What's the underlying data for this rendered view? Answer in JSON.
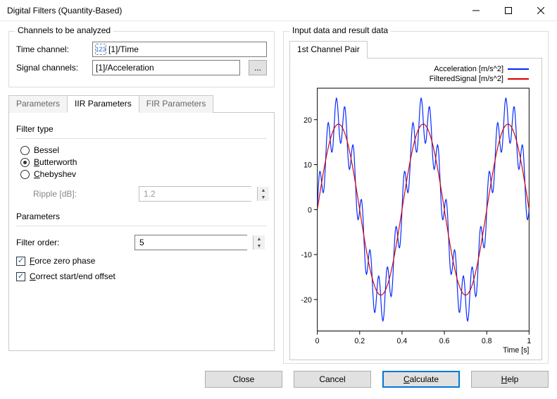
{
  "window": {
    "title": "Digital Filters (Quantity-Based)"
  },
  "channels": {
    "legend": "Channels to be analyzed",
    "time_label": "Time channel:",
    "time_value": "[1]/Time",
    "time_icon": "123",
    "signal_label": "Signal channels:",
    "signal_value": "[1]/Acceleration",
    "browse_label": "..."
  },
  "tabs": {
    "items": [
      "Parameters",
      "IIR Parameters",
      "FIR Parameters"
    ],
    "active_index": 1
  },
  "filter_type": {
    "legend": "Filter type",
    "options": [
      "Bessel",
      "Butterworth",
      "Chebyshev"
    ],
    "selected_index": 1,
    "ripple_label": "Ripple [dB]:",
    "ripple_value": "1.2"
  },
  "parameters": {
    "legend": "Parameters",
    "filter_order_label": "Filter order:",
    "filter_order_value": "5",
    "force_zero_phase_label": "Force zero phase",
    "force_zero_phase_checked": true,
    "correct_offset_label": "Correct start/end offset",
    "correct_offset_checked": true
  },
  "result": {
    "legend": "Input data and result data",
    "tab_label": "1st Channel Pair",
    "legend_entries": [
      {
        "label": "Acceleration [m/s^2]",
        "color": "#0026ff"
      },
      {
        "label": "FilteredSignal [m/s^2]",
        "color": "#d60000"
      }
    ],
    "xlabel": "Time [s]"
  },
  "buttons": {
    "close": "Close",
    "cancel": "Cancel",
    "calculate": "Calculate",
    "help": "Help"
  },
  "chart_data": {
    "type": "line",
    "xlabel": "Time [s]",
    "ylabel": "",
    "x_ticks": [
      0,
      0.2,
      0.4,
      0.6,
      0.8,
      1
    ],
    "y_ticks": [
      -20,
      -10,
      0,
      10,
      20
    ],
    "xlim": [
      0,
      1
    ],
    "ylim": [
      -27,
      27
    ],
    "series": [
      {
        "name": "Acceleration [m/s^2]",
        "color": "#0026ff",
        "description": "sum of 2.5 Hz sine ~20 amplitude and ~25 Hz sine ~5 amplitude (noisy)",
        "x_sample_count": 501,
        "base": {
          "type": "sine",
          "freq_hz": 2.5,
          "amp": 20,
          "phase_deg": 0
        },
        "high": {
          "type": "sine",
          "freq_hz": 25,
          "amp": 5,
          "phase_deg": 0
        }
      },
      {
        "name": "FilteredSignal [m/s^2]",
        "color": "#d60000",
        "description": "low-pass filtered result — tracks the 2.5 Hz component",
        "x_sample_count": 501,
        "base": {
          "type": "sine",
          "freq_hz": 2.5,
          "amp": 19,
          "phase_deg": 0
        }
      }
    ]
  }
}
